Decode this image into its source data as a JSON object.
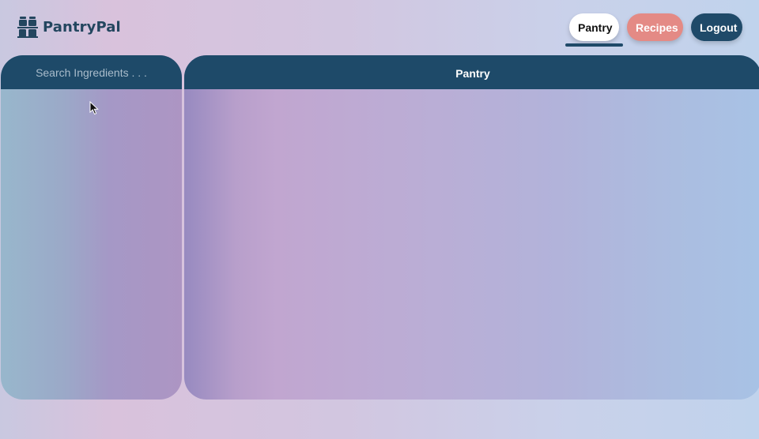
{
  "app": {
    "name": "PantryPal",
    "logo_icon": "jars-icon"
  },
  "nav": {
    "pantry_label": "Pantry",
    "recipes_label": "Recipes",
    "logout_label": "Logout",
    "active": "Pantry"
  },
  "search": {
    "placeholder": "Search Ingredients . . .",
    "value": ""
  },
  "main": {
    "title": "Pantry"
  },
  "colors": {
    "primary": "#1f4a69",
    "accent": "#e48a85",
    "surface": "#ffffff"
  }
}
